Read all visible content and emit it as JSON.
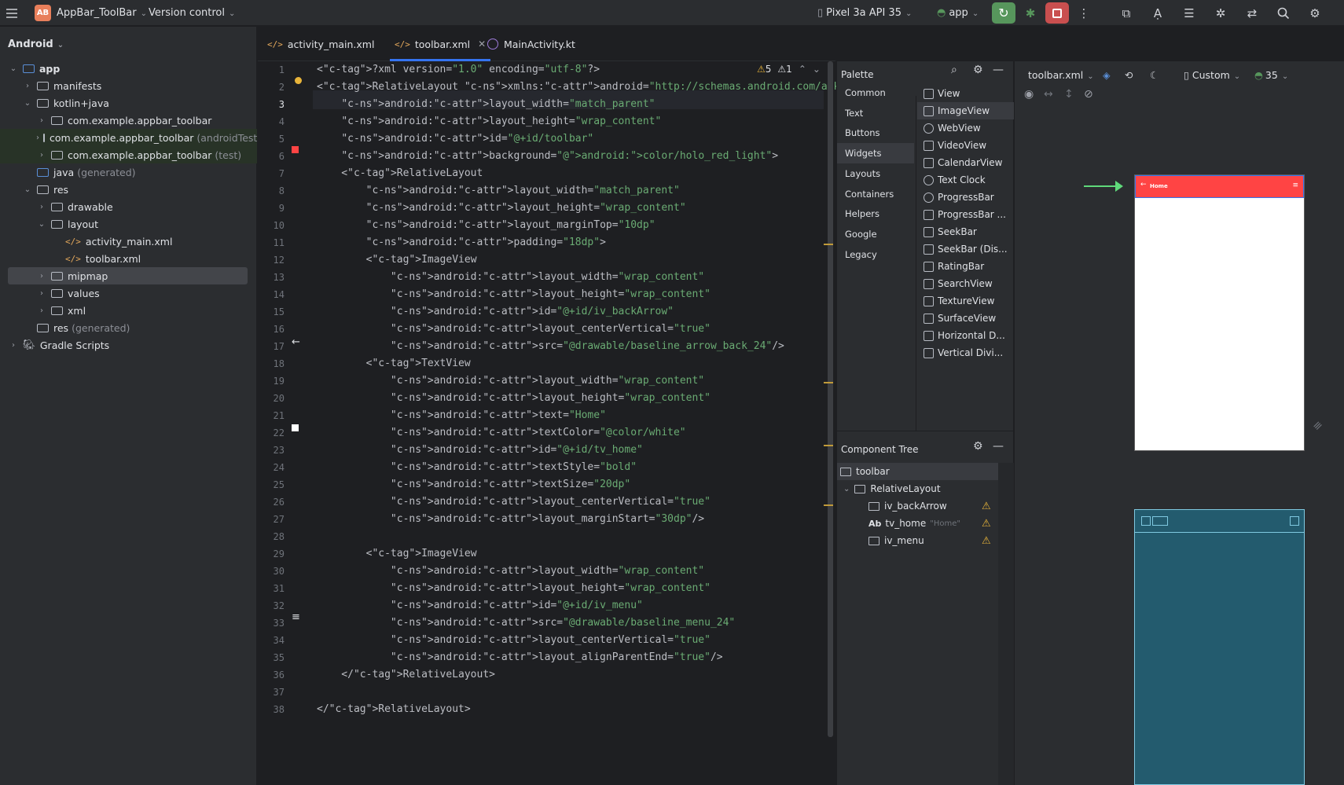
{
  "topbar": {
    "project_badge": "AB",
    "project_name": "AppBar_ToolBar",
    "vcs": "Version control",
    "device": "Pixel 3a API 35",
    "run_config": "app"
  },
  "project": {
    "view": "Android",
    "tree": [
      {
        "label": "app",
        "indent": 0,
        "arrow": "v",
        "icon": "module",
        "bold": true
      },
      {
        "label": "manifests",
        "indent": 1,
        "arrow": ">",
        "icon": "folder"
      },
      {
        "label": "kotlin+java",
        "indent": 1,
        "arrow": "v",
        "icon": "folder"
      },
      {
        "label": "com.example.appbar_toolbar",
        "indent": 2,
        "arrow": ">",
        "icon": "package"
      },
      {
        "label": "com.example.appbar_toolbar",
        "suffix": "(androidTest)",
        "indent": 2,
        "arrow": ">",
        "icon": "package",
        "green": true
      },
      {
        "label": "com.example.appbar_toolbar",
        "suffix": "(test)",
        "indent": 2,
        "arrow": ">",
        "icon": "package",
        "green": true
      },
      {
        "label": "java",
        "suffix": "(generated)",
        "indent": 1,
        "arrow": "",
        "icon": "folder-blue"
      },
      {
        "label": "res",
        "indent": 1,
        "arrow": "v",
        "icon": "folder"
      },
      {
        "label": "drawable",
        "indent": 2,
        "arrow": ">",
        "icon": "folder"
      },
      {
        "label": "layout",
        "indent": 2,
        "arrow": "v",
        "icon": "folder"
      },
      {
        "label": "activity_main.xml",
        "indent": 3,
        "arrow": "",
        "icon": "xml"
      },
      {
        "label": "toolbar.xml",
        "indent": 3,
        "arrow": "",
        "icon": "xml"
      },
      {
        "label": "mipmap",
        "indent": 2,
        "arrow": ">",
        "icon": "folder",
        "selected": true
      },
      {
        "label": "values",
        "indent": 2,
        "arrow": ">",
        "icon": "folder"
      },
      {
        "label": "xml",
        "indent": 2,
        "arrow": ">",
        "icon": "folder"
      },
      {
        "label": "res",
        "suffix": "(generated)",
        "indent": 1,
        "arrow": "",
        "icon": "folder"
      },
      {
        "label": "Gradle Scripts",
        "indent": 0,
        "arrow": ">",
        "icon": "gradle"
      }
    ]
  },
  "tabs": [
    {
      "label": "activity_main.xml",
      "type": "xml"
    },
    {
      "label": "toolbar.xml",
      "type": "xml",
      "active": true
    },
    {
      "label": "MainActivity.kt",
      "type": "kt"
    }
  ],
  "inspections": {
    "warnings": "5",
    "weak_warnings": "1"
  },
  "code": [
    "<?xml version=\"1.0\" encoding=\"utf-8\"?>",
    "<RelativeLayout xmlns:android=\"http://schemas.android.com/apk/res/android\"",
    "    android:layout_width=\"match_parent\"",
    "    android:layout_height=\"wrap_content\"",
    "    android:id=\"@+id/toolbar\"",
    "    android:background=\"@android:color/holo_red_light\">",
    "    <RelativeLayout",
    "        android:layout_width=\"match_parent\"",
    "        android:layout_height=\"wrap_content\"",
    "        android:layout_marginTop=\"10dp\"",
    "        android:padding=\"18dp\">",
    "        <ImageView",
    "            android:layout_width=\"wrap_content\"",
    "            android:layout_height=\"wrap_content\"",
    "            android:id=\"@+id/iv_backArrow\"",
    "            android:layout_centerVertical=\"true\"",
    "            android:src=\"@drawable/baseline_arrow_back_24\"/>",
    "        <TextView",
    "            android:layout_width=\"wrap_content\"",
    "            android:layout_height=\"wrap_content\"",
    "            android:text=\"Home\"",
    "            android:textColor=\"@color/white\"",
    "            android:id=\"@+id/tv_home\"",
    "            android:textStyle=\"bold\"",
    "            android:textSize=\"20dp\"",
    "            android:layout_centerVertical=\"true\"",
    "            android:layout_marginStart=\"30dp\"/>",
    "",
    "        <ImageView",
    "            android:layout_width=\"wrap_content\"",
    "            android:layout_height=\"wrap_content\"",
    "            android:id=\"@+id/iv_menu\"",
    "            android:src=\"@drawable/baseline_menu_24\"",
    "            android:layout_centerVertical=\"true\"",
    "            android:layout_alignParentEnd=\"true\"/>",
    "    </RelativeLayout>",
    "",
    "</RelativeLayout>"
  ],
  "palette": {
    "title": "Palette",
    "categories": [
      "Common",
      "Text",
      "Buttons",
      "Widgets",
      "Layouts",
      "Containers",
      "Helpers",
      "Google",
      "Legacy"
    ],
    "selected_category": "Widgets",
    "items": [
      "View",
      "ImageView",
      "WebView",
      "VideoView",
      "CalendarView",
      "Text Clock",
      "ProgressBar",
      "ProgressBar ...",
      "SeekBar",
      "SeekBar (Dis...",
      "RatingBar",
      "SearchView",
      "TextureView",
      "SurfaceView",
      "Horizontal D...",
      "Vertical Divi..."
    ],
    "selected_item": "ImageView"
  },
  "component_tree": {
    "title": "Component Tree",
    "rows": [
      {
        "label": "toolbar",
        "indent": 0,
        "selected": true
      },
      {
        "label": "RelativeLayout",
        "indent": 1,
        "arrow": true
      },
      {
        "label": "iv_backArrow",
        "indent": 2,
        "warn": true
      },
      {
        "label": "tv_home",
        "hint": "\"Home\"",
        "indent": 2,
        "warn": true,
        "text": true
      },
      {
        "label": "iv_menu",
        "indent": 2,
        "warn": true
      }
    ]
  },
  "design": {
    "file": "toolbar.xml",
    "device_size": "Custom",
    "api": "35",
    "preview_title": "Home"
  },
  "colors": {
    "accent": "#3574f0",
    "toolbar_red": "#ff4444",
    "run_green": "#57965c",
    "stop_red": "#c94f4f"
  }
}
